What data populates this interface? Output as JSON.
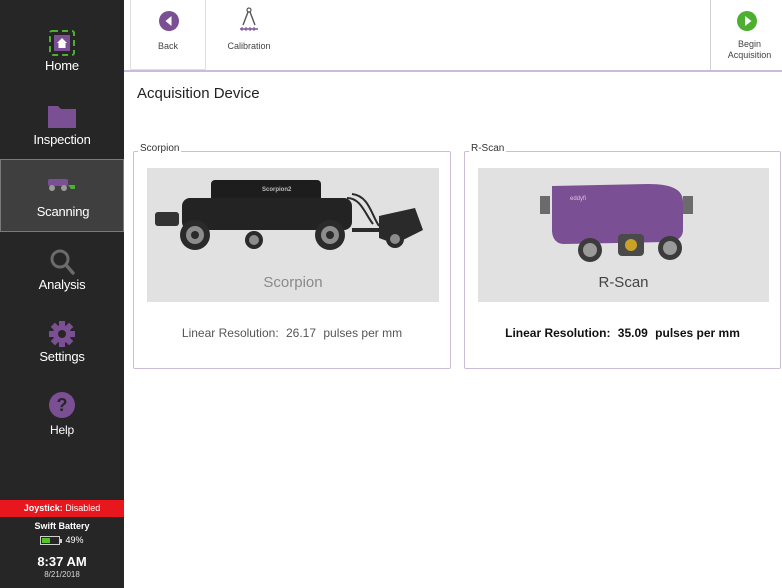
{
  "sidebar": {
    "items": [
      {
        "label": "Home",
        "icon": "home-icon"
      },
      {
        "label": "Inspection",
        "icon": "folder-icon"
      },
      {
        "label": "Scanning",
        "icon": "scanner-icon"
      },
      {
        "label": "Analysis",
        "icon": "search-icon"
      },
      {
        "label": "Settings",
        "icon": "gear-icon"
      },
      {
        "label": "Help",
        "icon": "help-icon"
      }
    ],
    "active": "Scanning",
    "status": {
      "joystick_label": "Joystick:",
      "joystick_value": "Disabled",
      "battery_title": "Swift Battery",
      "battery_percent": "49%",
      "battery_level": 0.49,
      "time": "8:37 AM",
      "date": "8/21/2018"
    }
  },
  "toolbar": {
    "back_label": "Back",
    "calibration_label": "Calibration",
    "begin_label": "Begin Acquisition",
    "accent_color": "#7b4f93",
    "go_color": "#4caf2f"
  },
  "page": {
    "title": "Acquisition Device"
  },
  "devices": [
    {
      "legend": "Scorpion",
      "image_caption": "Scorpion",
      "image_badge": "Scorpion2",
      "resolution_label": "Linear Resolution:",
      "resolution_value": "26.17",
      "resolution_unit": "pulses per mm"
    },
    {
      "legend": "R-Scan",
      "image_caption": "R-Scan",
      "image_badge": "eddyfi",
      "resolution_label": "Linear Resolution:",
      "resolution_value": "35.09",
      "resolution_unit": "pulses per mm"
    }
  ]
}
